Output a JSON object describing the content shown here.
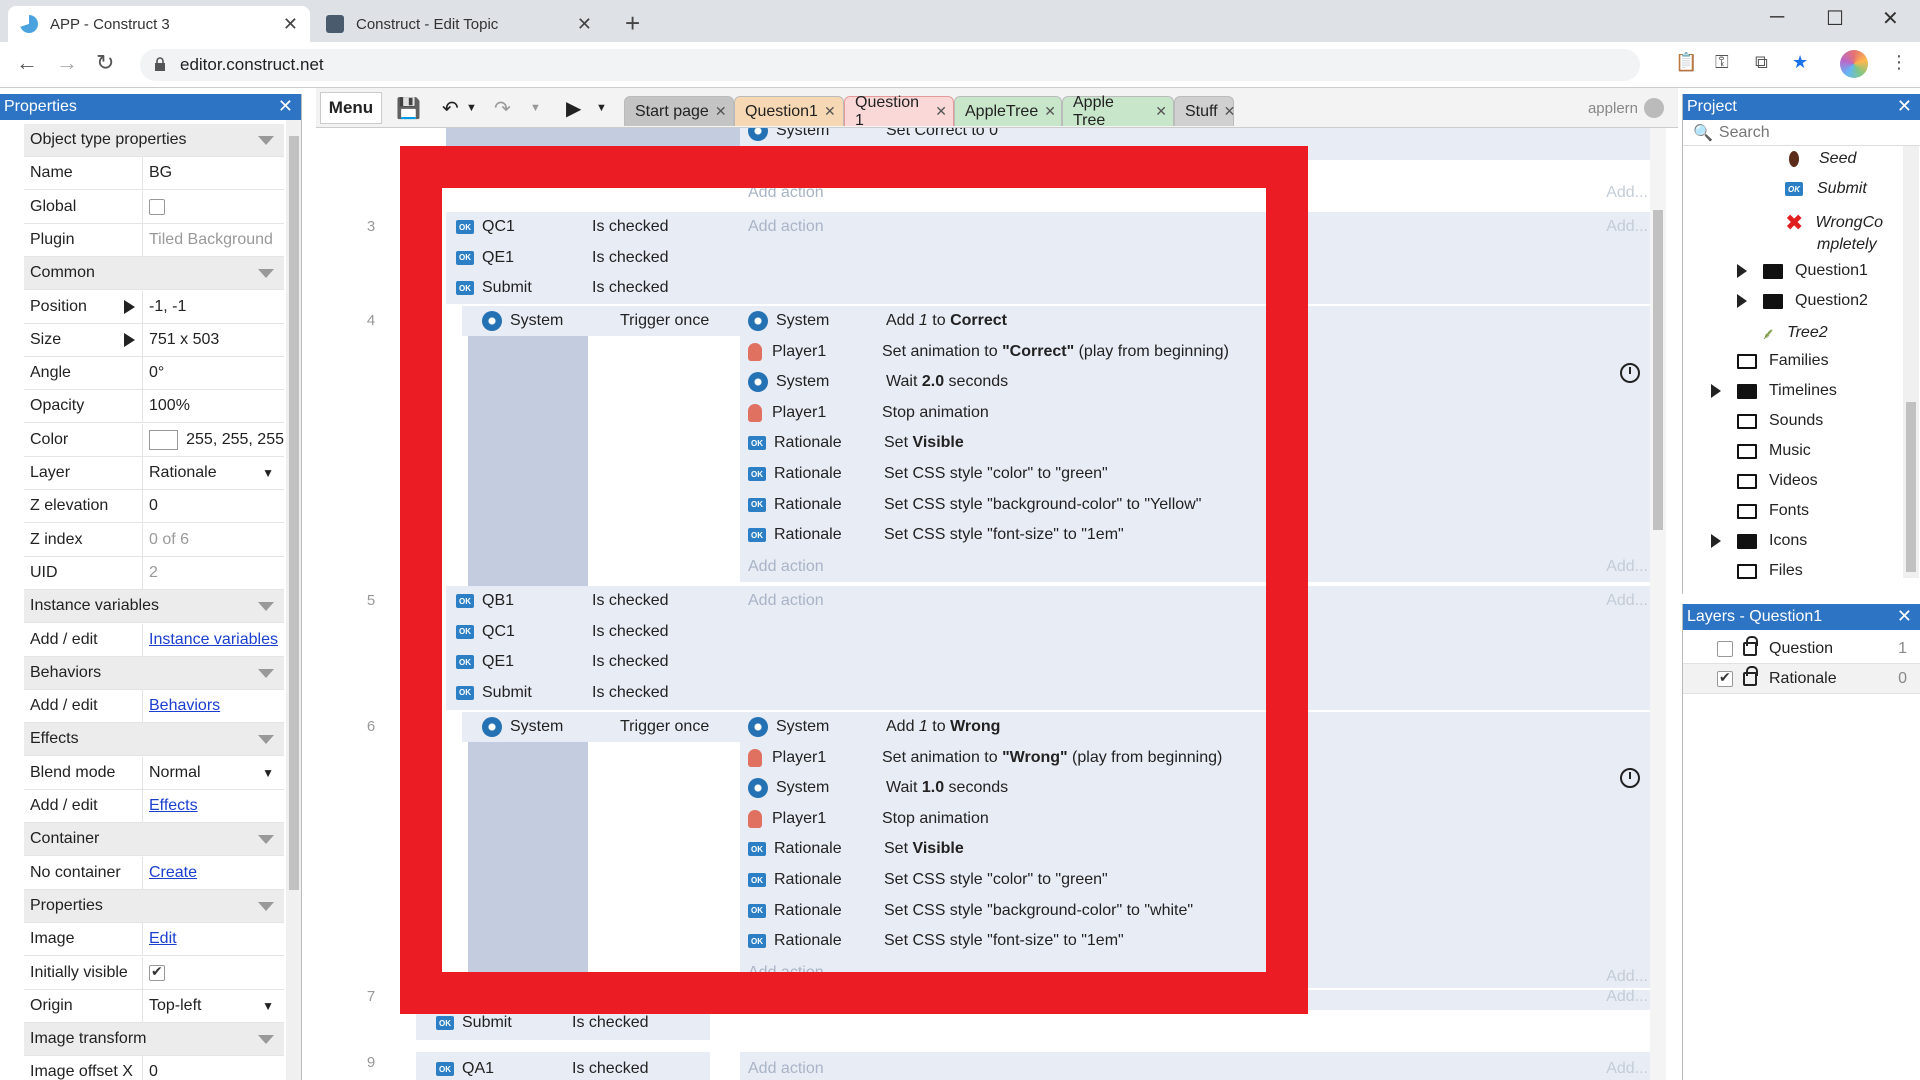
{
  "browser": {
    "tabs": [
      {
        "title": "APP - Construct 3",
        "close": "✕"
      },
      {
        "title": "Construct - Edit Topic",
        "close": "✕"
      }
    ],
    "new_tab": "+",
    "url": "editor.construct.net",
    "window": {
      "minimize": "─",
      "maximize": "☐",
      "close": "✕"
    }
  },
  "toolbar": {
    "menu_label": "Menu",
    "tabs": [
      {
        "label": "Start page",
        "bg": "#c4c4c4"
      },
      {
        "label": "Question1",
        "bg": "#f6d9b4"
      },
      {
        "label": "Question 1",
        "bg": "#fbd8d8"
      },
      {
        "label": "AppleTree",
        "bg": "#c8e6c9"
      },
      {
        "label": "Apple Tree",
        "bg": "#c8e6c9"
      },
      {
        "label": "Stuff",
        "bg": "#d0d0d0"
      }
    ],
    "user": "applern"
  },
  "properties": {
    "title": "Properties",
    "rows": [
      {
        "label": "Object type properties",
        "type": "section"
      },
      {
        "label": "Name",
        "value": "BG"
      },
      {
        "label": "Global",
        "type": "check",
        "checked": false
      },
      {
        "label": "Plugin",
        "value": "Tiled Background",
        "muted": true
      },
      {
        "label": "Common",
        "type": "section"
      },
      {
        "label": "Position",
        "value": "-1, -1",
        "expand": true
      },
      {
        "label": "Size",
        "value": "751 x 503",
        "expand": true
      },
      {
        "label": "Angle",
        "value": "0°"
      },
      {
        "label": "Opacity",
        "value": "100%"
      },
      {
        "label": "Color",
        "value": "255, 255, 255",
        "type": "color"
      },
      {
        "label": "Layer",
        "value": "Rationale",
        "type": "dropdown"
      },
      {
        "label": "Z elevation",
        "value": "0"
      },
      {
        "label": "Z index",
        "value": "0 of 6",
        "muted": true
      },
      {
        "label": "UID",
        "value": "2",
        "muted": true
      },
      {
        "label": "Instance variables",
        "type": "section"
      },
      {
        "label": "Add / edit",
        "value": "Instance variables",
        "type": "link"
      },
      {
        "label": "Behaviors",
        "type": "section"
      },
      {
        "label": "Add / edit",
        "value": "Behaviors",
        "type": "link"
      },
      {
        "label": "Effects",
        "type": "section"
      },
      {
        "label": "Blend mode",
        "value": "Normal",
        "type": "dropdown"
      },
      {
        "label": "Add / edit",
        "value": "Effects",
        "type": "link"
      },
      {
        "label": "Container",
        "type": "section"
      },
      {
        "label": "No container",
        "value": "Create",
        "type": "link"
      },
      {
        "label": "Properties",
        "type": "section"
      },
      {
        "label": "Image",
        "value": "Edit",
        "type": "link"
      },
      {
        "label": "Initially visible",
        "type": "check",
        "checked": true
      },
      {
        "label": "Origin",
        "value": "Top-left",
        "type": "dropdown"
      },
      {
        "label": "Image transform",
        "type": "section"
      },
      {
        "label": "Image offset X",
        "value": "0"
      }
    ]
  },
  "sheet": {
    "add_action": "Add action",
    "add_short": "Add...",
    "row_numbers": [
      "3",
      "4",
      "5",
      "6",
      "7",
      "9"
    ],
    "top_partial": {
      "object": "System",
      "action": "Set Correct to 0"
    },
    "event3": [
      {
        "object": "QC1",
        "condition": "Is checked"
      },
      {
        "object": "QE1",
        "condition": "Is checked"
      },
      {
        "object": "Submit",
        "condition": "Is checked"
      }
    ],
    "event4_condition": {
      "object": "System",
      "condition": "Trigger once"
    },
    "event4_actions": [
      {
        "icon": "gear",
        "object": "System",
        "pre": "Add ",
        "em": "1",
        "mid": " to ",
        "bold": "Correct",
        "post": ""
      },
      {
        "icon": "player",
        "object": "Player1",
        "pre": "Set animation to ",
        "bold": "\"Correct\"",
        "post": " (play from beginning)"
      },
      {
        "icon": "gear",
        "object": "System",
        "pre": "Wait ",
        "bold": "2.0",
        "post": " seconds"
      },
      {
        "icon": "player",
        "object": "Player1",
        "pre": "Stop animation",
        "bold": "",
        "post": ""
      },
      {
        "icon": "badge",
        "object": "Rationale",
        "pre": "Set ",
        "bold": "Visible",
        "post": ""
      },
      {
        "icon": "badge",
        "object": "Rationale",
        "pre": "Set CSS style \"color\" to \"green\"",
        "bold": "",
        "post": ""
      },
      {
        "icon": "badge",
        "object": "Rationale",
        "pre": "Set CSS style \"background-color\" to \"Yellow\"",
        "bold": "",
        "post": ""
      },
      {
        "icon": "badge",
        "object": "Rationale",
        "pre": "Set CSS style \"font-size\" to \"1em\"",
        "bold": "",
        "post": ""
      }
    ],
    "event5": [
      {
        "object": "QB1",
        "condition": "Is checked"
      },
      {
        "object": "QC1",
        "condition": "Is checked"
      },
      {
        "object": "QE1",
        "condition": "Is checked"
      },
      {
        "object": "Submit",
        "condition": "Is checked"
      }
    ],
    "event6_condition": {
      "object": "System",
      "condition": "Trigger once"
    },
    "event6_actions": [
      {
        "icon": "gear",
        "object": "System",
        "pre": "Add ",
        "em": "1",
        "mid": " to ",
        "bold": "Wrong",
        "post": ""
      },
      {
        "icon": "player",
        "object": "Player1",
        "pre": "Set animation to ",
        "bold": "\"Wrong\"",
        "post": " (play from beginning)"
      },
      {
        "icon": "gear",
        "object": "System",
        "pre": "Wait ",
        "bold": "1.0",
        "post": " seconds"
      },
      {
        "icon": "player",
        "object": "Player1",
        "pre": "Stop animation",
        "bold": "",
        "post": ""
      },
      {
        "icon": "badge",
        "object": "Rationale",
        "pre": "Set ",
        "bold": "Visible",
        "post": ""
      },
      {
        "icon": "badge",
        "object": "Rationale",
        "pre": "Set CSS style \"color\" to \"green\"",
        "bold": "",
        "post": ""
      },
      {
        "icon": "badge",
        "object": "Rationale",
        "pre": "Set CSS style \"background-color\" to \"white\"",
        "bold": "",
        "post": ""
      },
      {
        "icon": "badge",
        "object": "Rationale",
        "pre": "Set CSS style \"font-size\" to \"1em\"",
        "bold": "",
        "post": ""
      }
    ],
    "event7": {
      "object": "Submit",
      "condition": "Is checked"
    },
    "event9": {
      "object": "QA1",
      "condition": "Is checked"
    },
    "highlight_color": "#ec1c24"
  },
  "project": {
    "title": "Project",
    "search_placeholder": "Search",
    "items": [
      {
        "label": "Seed",
        "kind": "seed",
        "italic": true
      },
      {
        "label": "Submit",
        "kind": "badge",
        "italic": true
      },
      {
        "label": "WrongCo",
        "kind": "wrong",
        "italic": true
      },
      {
        "label": "mpletely",
        "kind": "cont",
        "italic": true
      },
      {
        "label": "Question1",
        "kind": "folder-filled",
        "expand": true
      },
      {
        "label": "Question2",
        "kind": "folder-filled",
        "expand": true
      },
      {
        "label": "Tree2",
        "kind": "tree",
        "italic": true
      },
      {
        "label": "Families",
        "kind": "folder-open"
      },
      {
        "label": "Timelines",
        "kind": "folder-filled",
        "expand": true
      },
      {
        "label": "Sounds",
        "kind": "folder-open"
      },
      {
        "label": "Music",
        "kind": "folder-open"
      },
      {
        "label": "Videos",
        "kind": "folder-open"
      },
      {
        "label": "Fonts",
        "kind": "folder-open"
      },
      {
        "label": "Icons",
        "kind": "folder-filled",
        "expand": true
      },
      {
        "label": "Files",
        "kind": "folder-open"
      }
    ]
  },
  "layers": {
    "title": "Layers - Question1",
    "rows": [
      {
        "name": "Question",
        "index": "1",
        "visible": false
      },
      {
        "name": "Rationale",
        "index": "0",
        "visible": true
      }
    ]
  }
}
